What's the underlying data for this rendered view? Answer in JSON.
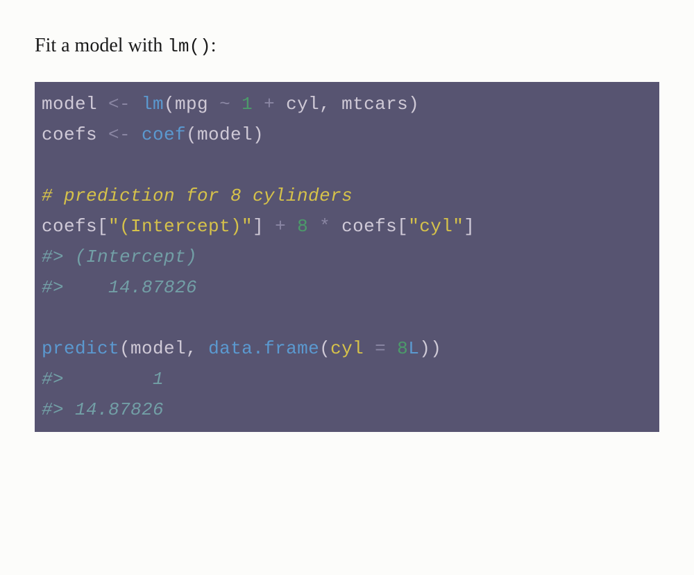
{
  "intro": {
    "prefix": "Fit a model with ",
    "code": "lm()",
    "suffix": ":"
  },
  "code": {
    "l1_model": "model",
    "l1_assign": " <- ",
    "l1_lm": "lm",
    "l1_open": "(mpg ",
    "l1_tilde": "~",
    "l1_sp1": " ",
    "l1_one": "1",
    "l1_sp2": " ",
    "l1_plus": "+",
    "l1_rest": " cyl, mtcars)",
    "l2_coefs": "coefs",
    "l2_assign": " <- ",
    "l2_coef": "coef",
    "l2_rest": "(model)",
    "l3_blank": "",
    "l4_comment": "# prediction for 8 cylinders",
    "l5_a": "coefs[",
    "l5_str1": "\"(Intercept)\"",
    "l5_b": "]",
    "l5_sp1": " ",
    "l5_plus": "+",
    "l5_sp2": " ",
    "l5_eight": "8",
    "l5_sp3": " ",
    "l5_star": "*",
    "l5_sp4": " coefs[",
    "l5_str2": "\"cyl\"",
    "l5_c": "]",
    "l6_out": "#> (Intercept)",
    "l7_out": "#>    14.87826",
    "l8_blank": "",
    "l9_predict": "predict",
    "l9_a": "(model, ",
    "l9_df": "data.frame",
    "l9_open": "(",
    "l9_cyl": "cyl",
    "l9_sp": " ",
    "l9_eq": "=",
    "l9_sp2": " ",
    "l9_eight": "8",
    "l9_L": "L",
    "l9_close": "))",
    "l10_out": "#>        1",
    "l11_out": "#> 14.87826"
  }
}
